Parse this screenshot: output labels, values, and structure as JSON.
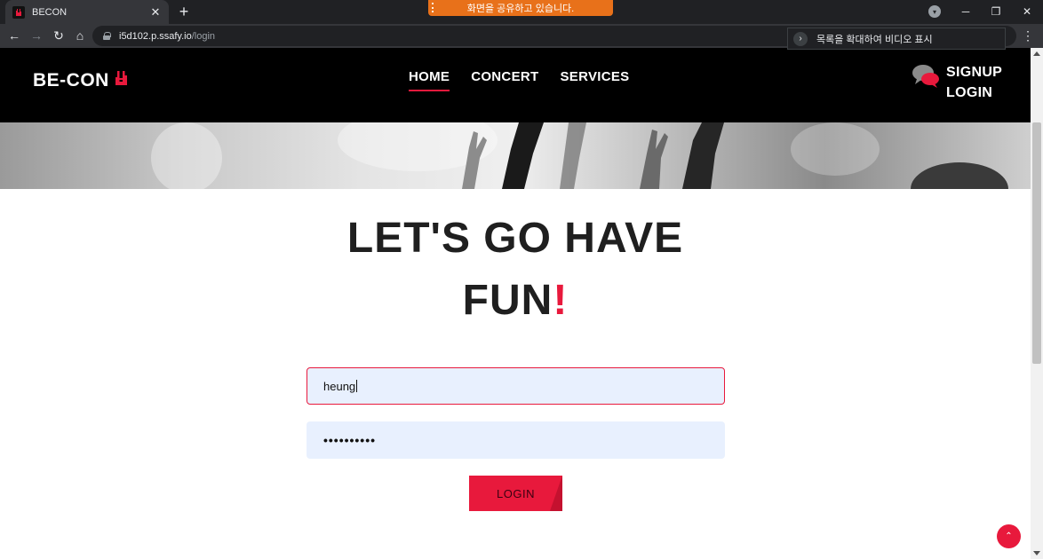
{
  "browser": {
    "tab_title": "BECON",
    "tab_close": "✕",
    "new_tab": "+",
    "share_banner": "화면을 공유하고 있습니다.",
    "url_host": "i5d102.p.ssafy.io",
    "url_path": "/login",
    "pip_popup": "목록을 확대하여 비디오 표시",
    "window_controls": {
      "minimize": "─",
      "maximize": "❐",
      "close": "✕"
    },
    "nav_icons": {
      "back": "←",
      "forward": "→",
      "reload": "↻",
      "home": "⌂",
      "menu": "⋮"
    }
  },
  "header": {
    "logo_text": "BE-CON",
    "nav": [
      {
        "label": "HOME",
        "active": true
      },
      {
        "label": "CONCERT",
        "active": false
      },
      {
        "label": "SERVICES",
        "active": false
      }
    ],
    "signup_label": "SIGNUP",
    "login_label": "LOGIN"
  },
  "main": {
    "headline_line1": "LET'S GO HAVE",
    "headline_line2": "FUN",
    "headline_mark": "!"
  },
  "form": {
    "username_value": "heung",
    "password_value": "••••••••••",
    "submit_label": "LOGIN"
  },
  "colors": {
    "accent": "#e8193c",
    "header_bg": "#000000",
    "input_bg": "#e8f0fe"
  },
  "icons": {
    "favicon": "rock-hand-icon",
    "chat": "chat-bubbles-icon",
    "scroll_top": "chevron-up-icon"
  }
}
